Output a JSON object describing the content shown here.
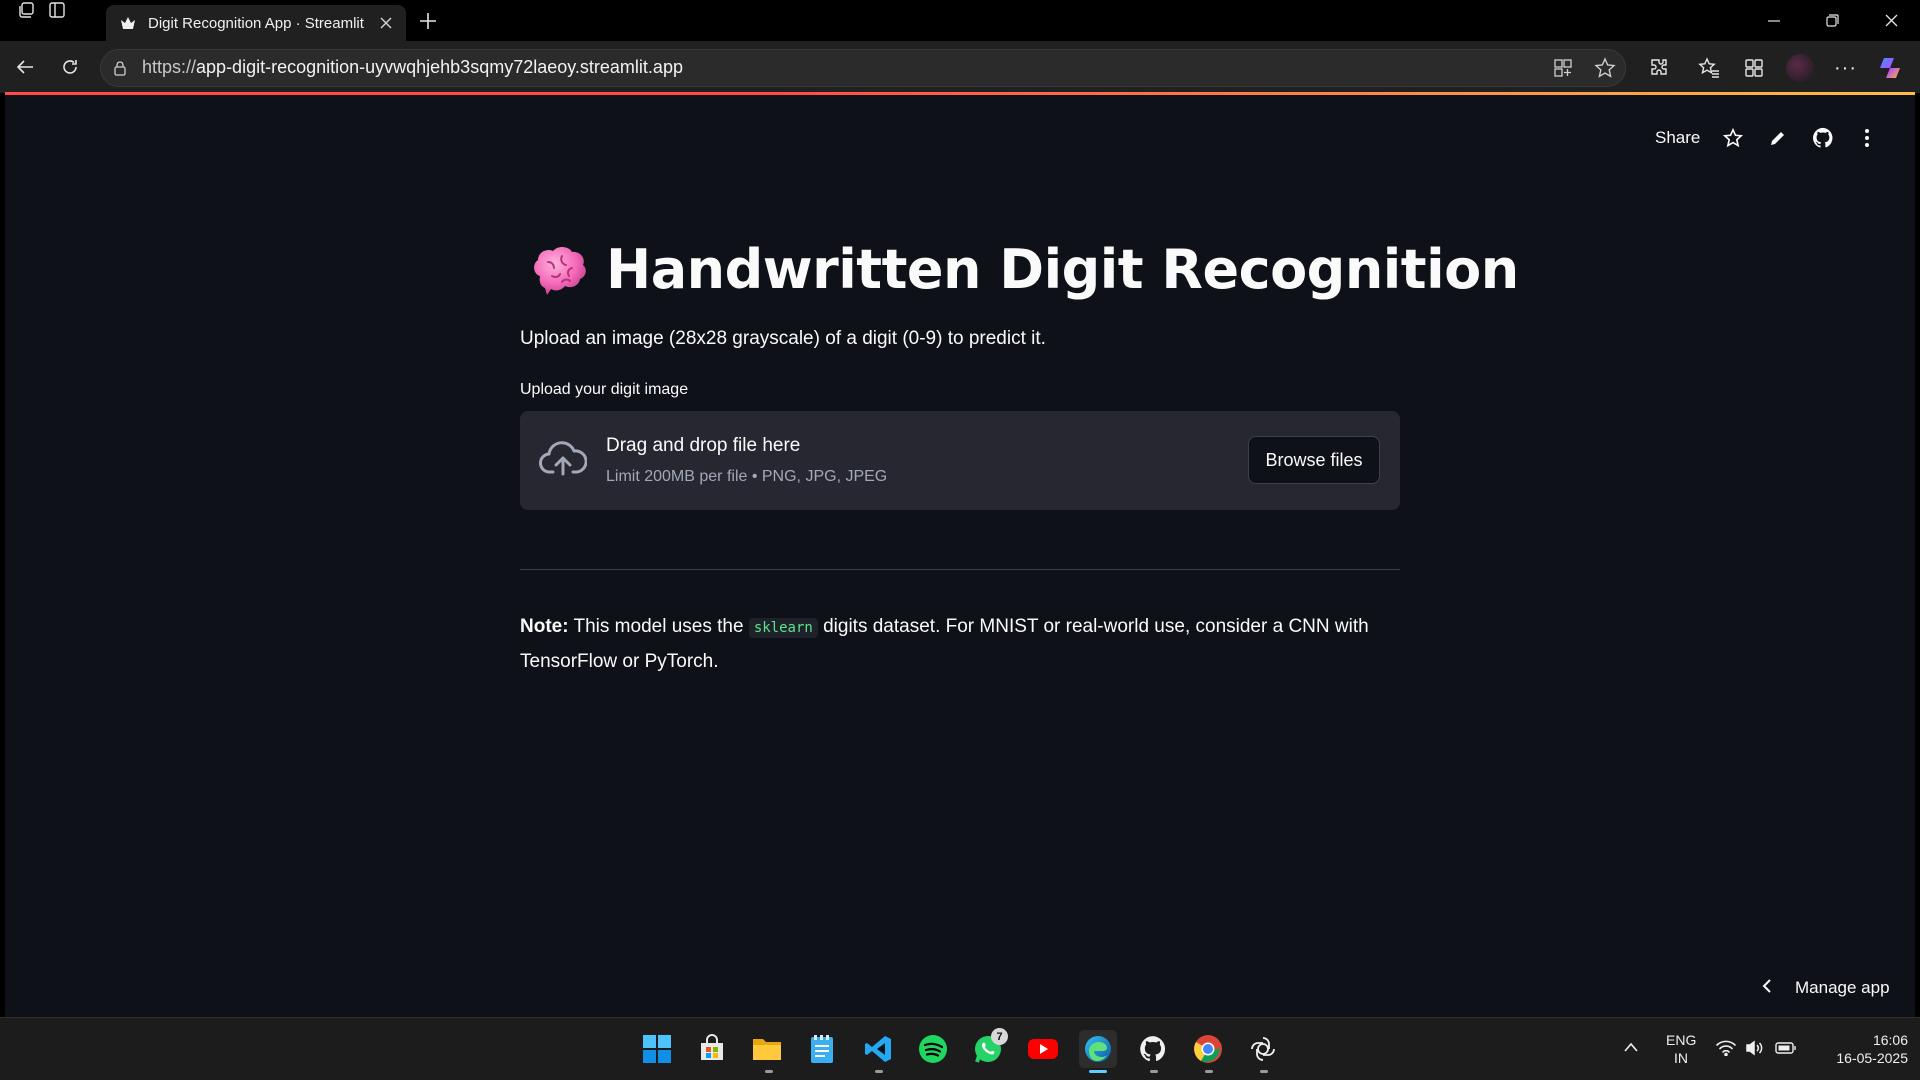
{
  "browser": {
    "tab_title": "Digit Recognition App · Streamlit",
    "url_scheme": "https://",
    "url_host": "app-digit-recognition-uyvwqhjehb3sqmy72laeoy.streamlit.app"
  },
  "header": {
    "share_label": "Share"
  },
  "main": {
    "title_emoji": "🧠",
    "title": "Handwritten Digit Recognition",
    "subtitle": "Upload an image (28x28 grayscale) of a digit (0-9) to predict it.",
    "uploader_label": "Upload your digit image",
    "dropzone_title": "Drag and drop file here",
    "dropzone_subtitle": "Limit 200MB per file • PNG, JPG, JPEG",
    "browse_label": "Browse files",
    "note_bold": "Note:",
    "note_pre": "This model uses the",
    "note_code": "sklearn",
    "note_post": "digits dataset. For MNIST or real-world use, consider a CNN with TensorFlow or PyTorch."
  },
  "footer": {
    "manage_label": "Manage app"
  },
  "taskbar": {
    "apps": [
      "start",
      "microsoft-store",
      "file-explorer",
      "notepad",
      "vscode",
      "spotify",
      "whatsapp",
      "youtube",
      "edge",
      "github",
      "chrome",
      "chatgpt"
    ],
    "whatsapp_badge": "7",
    "lang_line1": "ENG",
    "lang_line2": "IN",
    "time": "16:06",
    "date": "16-05-2025"
  },
  "colors": {
    "app_bg": "#0e1117",
    "accent_red": "#ff4b4b",
    "dropzone_bg": "#262730",
    "code_green": "#5ce488"
  }
}
